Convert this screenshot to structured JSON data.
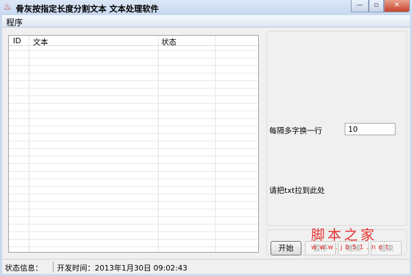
{
  "window": {
    "title": "骨灰按指定长度分割文本 文本处理软件",
    "minimize": "—",
    "maximize": "▫",
    "close": "✕"
  },
  "menu": {
    "items": [
      {
        "label": "程序"
      }
    ]
  },
  "list": {
    "columns": [
      "ID",
      "文本",
      "状态",
      ""
    ],
    "rows": []
  },
  "settings": {
    "chars_per_line_label": "每隔多字换一行",
    "chars_per_line_value": "10",
    "drop_hint": "请把txt拉到此处"
  },
  "buttons": {
    "start": "开始",
    "pause": "暂停",
    "resume": "继续",
    "stop": "结束"
  },
  "status": {
    "label": "状态信息：",
    "dev_time": "开发时间：2013年1月30日 09:02:43"
  },
  "watermark": {
    "line1": "脚本之家",
    "line2": "www.jb51.net"
  }
}
